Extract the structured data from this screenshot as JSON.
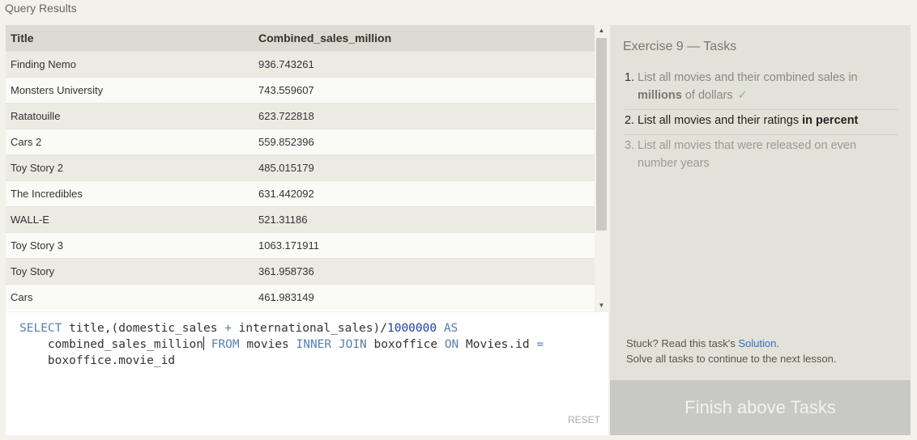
{
  "results": {
    "title": "Query Results",
    "columns": [
      "Title",
      "Combined_sales_million"
    ],
    "rows": [
      [
        "Finding Nemo",
        "936.743261"
      ],
      [
        "Monsters University",
        "743.559607"
      ],
      [
        "Ratatouille",
        "623.722818"
      ],
      [
        "Cars 2",
        "559.852396"
      ],
      [
        "Toy Story 2",
        "485.015179"
      ],
      [
        "The Incredibles",
        "631.442092"
      ],
      [
        "WALL-E",
        "521.31186"
      ],
      [
        "Toy Story 3",
        "1063.171911"
      ],
      [
        "Toy Story",
        "361.958736"
      ],
      [
        "Cars",
        "461.983149"
      ]
    ]
  },
  "editor": {
    "line1": {
      "kw1": "SELECT",
      "t1": " title,(domestic_sales ",
      "op1": "+",
      "t2": " international_sales)/",
      "num": "1000000",
      "sp": " ",
      "kw2": "AS"
    },
    "line2": {
      "indent": "    ",
      "t1": "combined_sales_million",
      "sp": " ",
      "kw1": "FROM",
      "t2": " movies ",
      "kw2": "INNER JOIN",
      "t3": " boxoffice ",
      "kw3": "ON",
      "t4": " Movies.id ",
      "op": "="
    },
    "line3": {
      "indent": "    ",
      "t1": "boxoffice.movie_id"
    },
    "reset_label": "RESET"
  },
  "tasks": {
    "title": "Exercise 9 — Tasks",
    "items": [
      {
        "num": "1.",
        "pre": "List all movies and their combined sales in ",
        "bold": "millions",
        "post": " of dollars",
        "check": "✓",
        "status": "done"
      },
      {
        "num": "2.",
        "pre": "List all movies and their ratings ",
        "bold": "in percent",
        "post": "",
        "status": "current"
      },
      {
        "num": "3.",
        "pre": "List all movies that were released on even number years",
        "status": "pending"
      }
    ],
    "stuck_text": "Stuck? Read this task's ",
    "solution_link": "Solution",
    "stuck_period": ".",
    "continue_text": "Solve all tasks to continue to the next lesson.",
    "finish_label": "Finish above Tasks"
  }
}
